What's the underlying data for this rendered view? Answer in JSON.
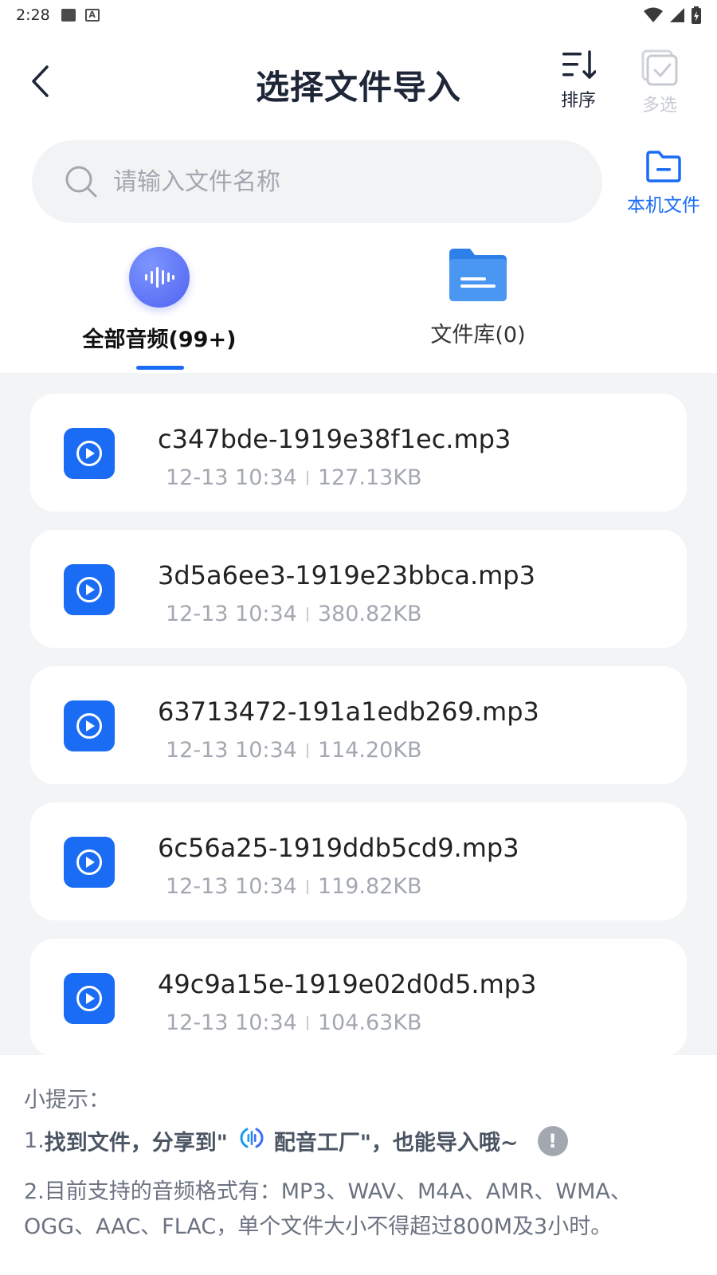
{
  "status_bar": {
    "time": "2:28"
  },
  "header": {
    "title": "选择文件导入",
    "sort_label": "排序",
    "multi_select_label": "多选"
  },
  "search": {
    "placeholder": "请输入文件名称"
  },
  "local_files": {
    "label": "本机文件"
  },
  "tabs": [
    {
      "label": "全部音频(99+)",
      "active": true,
      "icon": "audio-wave-icon"
    },
    {
      "label": "文件库(0)",
      "active": false,
      "icon": "folder-icon"
    }
  ],
  "files": [
    {
      "name": "c347bde-1919e38f1ec.mp3",
      "date": "12-13 10:34",
      "size": "127.13KB"
    },
    {
      "name": "3d5a6ee3-1919e23bbca.mp3",
      "date": "12-13 10:34",
      "size": "380.82KB"
    },
    {
      "name": "63713472-191a1edb269.mp3",
      "date": "12-13 10:34",
      "size": "114.20KB"
    },
    {
      "name": "6c56a25-1919ddb5cd9.mp3",
      "date": "12-13 10:34",
      "size": "119.82KB"
    },
    {
      "name": "49c9a15e-1919e02d0d5.mp3",
      "date": "12-13 10:34",
      "size": "104.63KB"
    }
  ],
  "tips": {
    "title": "小提示：",
    "line1_prefix": "1.",
    "line1_strong_a": "找到文件，分享到\"",
    "line1_strong_b": "配音工厂\"，也能导入哦~",
    "info_symbol": "!",
    "line2": "2.目前支持的音频格式有：MP3、WAV、M4A、AMR、WMA、OGG、AAC、FLAC，单个文件大小不得超过800M及3小时。"
  },
  "colors": {
    "accent": "#1a6cf5",
    "list_bg": "#f3f4f6",
    "muted_text": "#a3a8b0"
  }
}
